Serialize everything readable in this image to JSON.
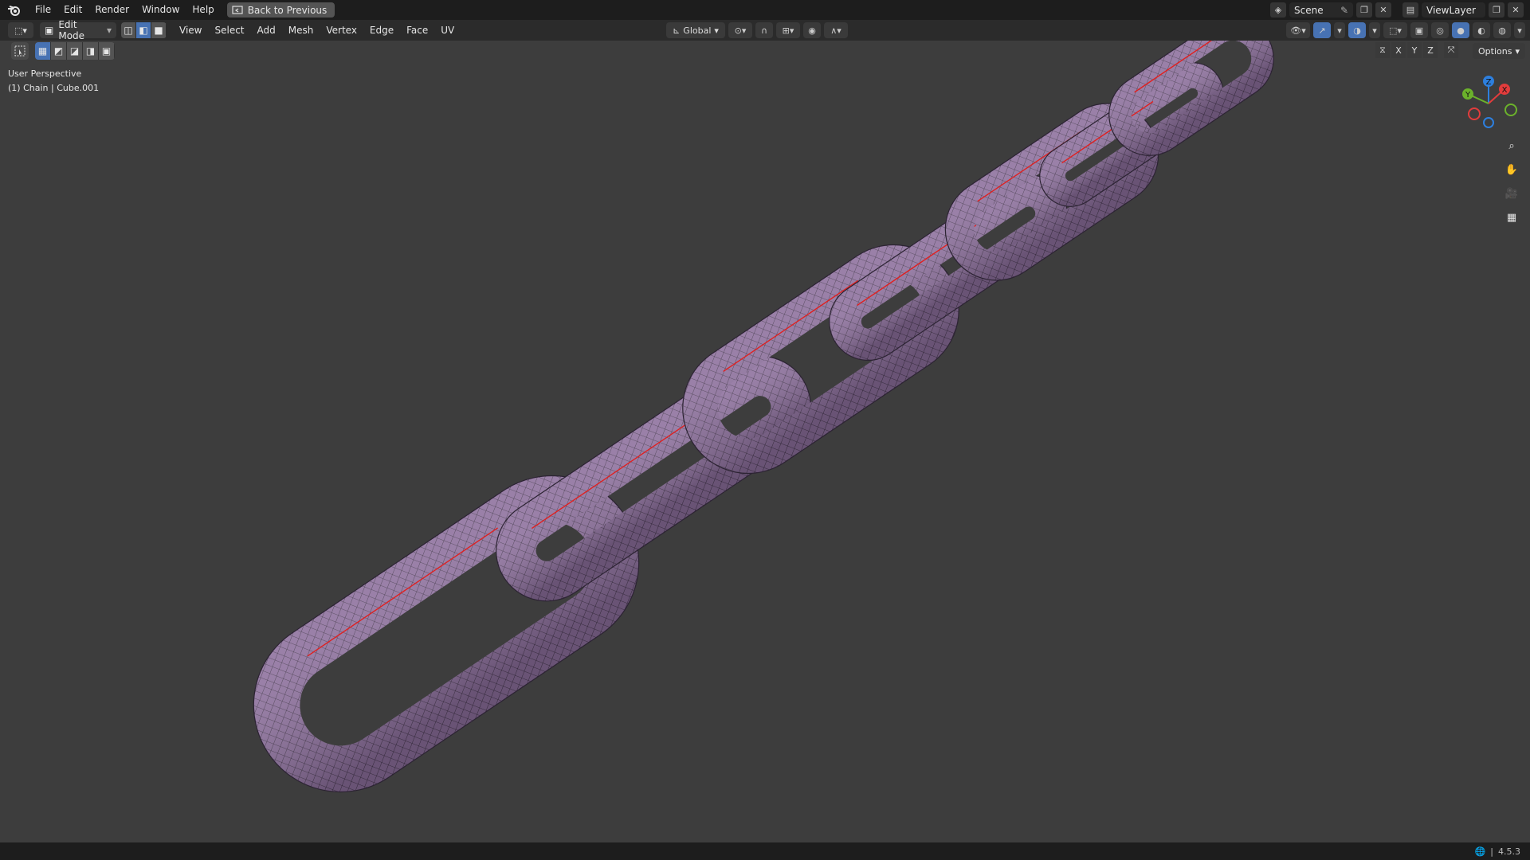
{
  "app": {
    "menus": [
      "File",
      "Edit",
      "Render",
      "Window",
      "Help"
    ],
    "back_button": "Back to Previous",
    "scene_name": "Scene",
    "view_layer": "ViewLayer"
  },
  "header": {
    "mode": "Edit Mode",
    "menus": [
      "View",
      "Select",
      "Add",
      "Mesh",
      "Vertex",
      "Edge",
      "Face",
      "UV"
    ],
    "transform_orientation": "Global"
  },
  "toolrow": {
    "axis_x": "X",
    "axis_y": "Y",
    "axis_z": "Z",
    "options_label": "Options"
  },
  "viewport": {
    "perspective_label": "User Perspective",
    "object_label": "(1) Chain | Cube.001",
    "mesh_color": "#8c6f9c",
    "seam_color": "#e02020"
  },
  "gizmo": {
    "x_label": "X",
    "y_label": "Y",
    "z_label": "Z",
    "x_color": "#e23c3c",
    "y_color": "#6bb22b",
    "z_color": "#2d7fde"
  },
  "statusbar": {
    "version": "4.5.3"
  }
}
